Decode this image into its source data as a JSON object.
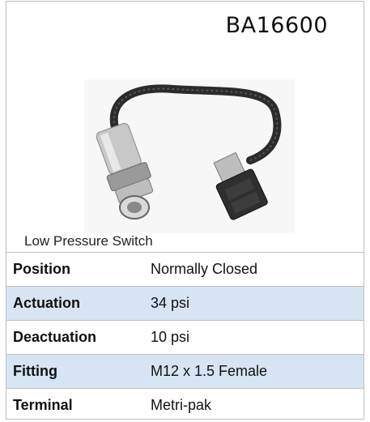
{
  "product": {
    "part_number": "BA16600",
    "caption": "Low Pressure Switch",
    "image_icon": "pressure-switch-photo"
  },
  "specs": [
    {
      "label": "Position",
      "value": "Normally Closed"
    },
    {
      "label": "Actuation",
      "value": "34 psi"
    },
    {
      "label": "Deactuation",
      "value": "10 psi"
    },
    {
      "label": "Fitting",
      "value": "M12 x 1.5 Female"
    },
    {
      "label": "Terminal",
      "value": "Metri-pak"
    }
  ],
  "colors": {
    "stripe": "#d7e4f3",
    "border": "#bfbfbf"
  }
}
